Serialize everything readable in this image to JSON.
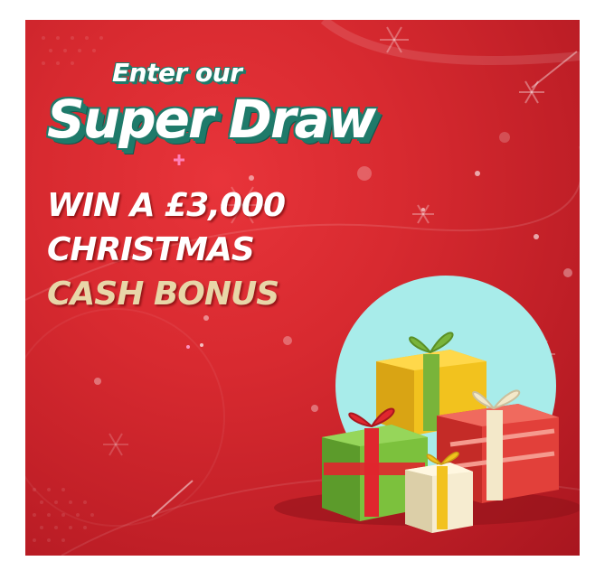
{
  "promo": {
    "kicker": "Enter our",
    "title": "Super Draw",
    "prize_line_1": "WIN A £3,000",
    "prize_line_2": "CHRISTMAS",
    "prize_line_3": "CASH BONUS"
  },
  "colors": {
    "background_red": "#d82a30",
    "title_outline_teal": "#1f7a6a",
    "bonus_gold": "#e8d6a8",
    "mint_circle": "#a8ecea"
  },
  "decorations": {
    "icons": [
      "snowflake-icon",
      "gift-box-icon",
      "sparkle-icon"
    ]
  }
}
